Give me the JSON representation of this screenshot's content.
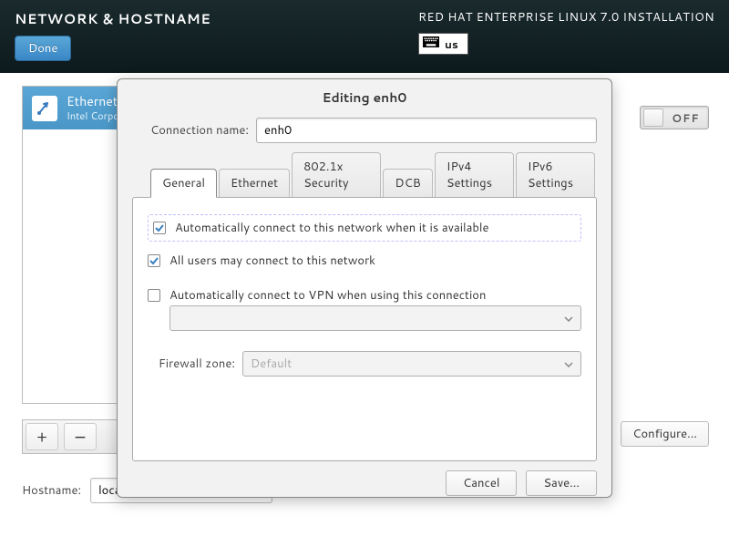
{
  "header": {
    "title": "NETWORK & HOSTNAME",
    "done_label": "Done",
    "installer": "RED HAT ENTERPRISE LINUX 7.0 INSTALLATION",
    "kb_layout": "us"
  },
  "nic": {
    "name": "Ethernet",
    "sub": "Intel Corporation"
  },
  "toggle": {
    "state_label": "OFF"
  },
  "configure_label": "Configure...",
  "hostname": {
    "label": "Hostname:",
    "value": "local"
  },
  "dialog": {
    "title": "Editing enh0",
    "conn_name_label": "Connection name:",
    "conn_name_value": "enh0",
    "tabs": [
      "General",
      "Ethernet",
      "802.1x Security",
      "DCB",
      "IPv4 Settings",
      "IPv6 Settings"
    ],
    "checks": {
      "auto_connect": "Automatically connect to this network when it is available",
      "all_users": "All users may connect to this network",
      "auto_vpn": "Automatically connect to VPN when using this connection"
    },
    "firewall_label": "Firewall zone:",
    "firewall_value": "Default",
    "cancel": "Cancel",
    "save": "Save..."
  },
  "buttons": {
    "plus": "+",
    "minus": "−"
  }
}
